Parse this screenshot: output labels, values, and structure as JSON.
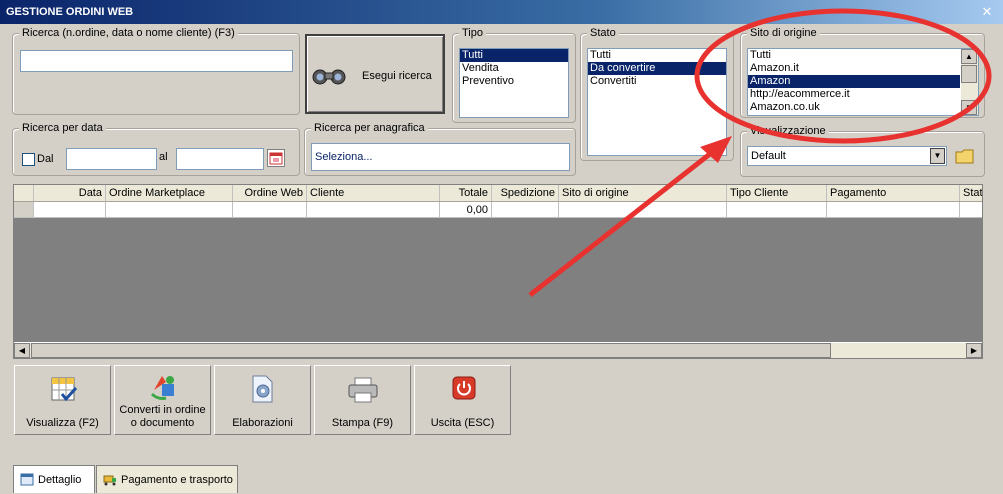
{
  "window": {
    "title": "GESTIONE ORDINI WEB",
    "close_glyph": "✕"
  },
  "search": {
    "legend": "Ricerca (n.ordine, data o nome cliente) (F3)",
    "value": "",
    "button_label": "Esegui ricerca",
    "button_icon": "binoculars-icon"
  },
  "tipo": {
    "legend": "Tipo",
    "items": [
      "Tutti",
      "Vendita",
      "Preventivo"
    ],
    "selected_index": 0
  },
  "stato": {
    "legend": "Stato",
    "items": [
      "Tutti",
      "Da convertire",
      "Convertiti"
    ],
    "selected_index": 1
  },
  "sito": {
    "legend": "Sito di origine",
    "items": [
      "Tutti",
      "Amazon.it",
      "Amazon",
      "http://eacommerce.it",
      "Amazon.co.uk"
    ],
    "selected_index": 2
  },
  "data_range": {
    "legend": "Ricerca per data",
    "dal_label": "Dal",
    "al_label": "al",
    "dal_value": "",
    "al_value": ""
  },
  "anagrafica": {
    "legend": "Ricerca per anagrafica",
    "value": "Seleziona..."
  },
  "visualizzazione": {
    "legend": "Visualizzazione",
    "value": "Default"
  },
  "grid": {
    "columns": [
      "Data",
      "Ordine Marketplace",
      "Ordine Web",
      "Cliente",
      "Totale",
      "Spedizione",
      "Sito di origine",
      "Tipo Cliente",
      "Pagamento",
      "Stat"
    ],
    "rows": [
      [
        "",
        "",
        "",
        "",
        "0,00",
        "",
        "",
        "",
        "",
        ""
      ]
    ]
  },
  "toolbar": {
    "visualizza": "Visualizza (F2)",
    "converti_line1": "Converti in ordine",
    "converti_line2": "o documento",
    "elaborazioni": "Elaborazioni",
    "stampa": "Stampa (F9)",
    "uscita": "Uscita (ESC)"
  },
  "tabs": {
    "dettaglio": "Dettaglio",
    "pagamento": "Pagamento e trasporto"
  },
  "colors": {
    "selection": "#0a246a",
    "annotation": "#e8322f",
    "title_start": "#0a246a"
  }
}
